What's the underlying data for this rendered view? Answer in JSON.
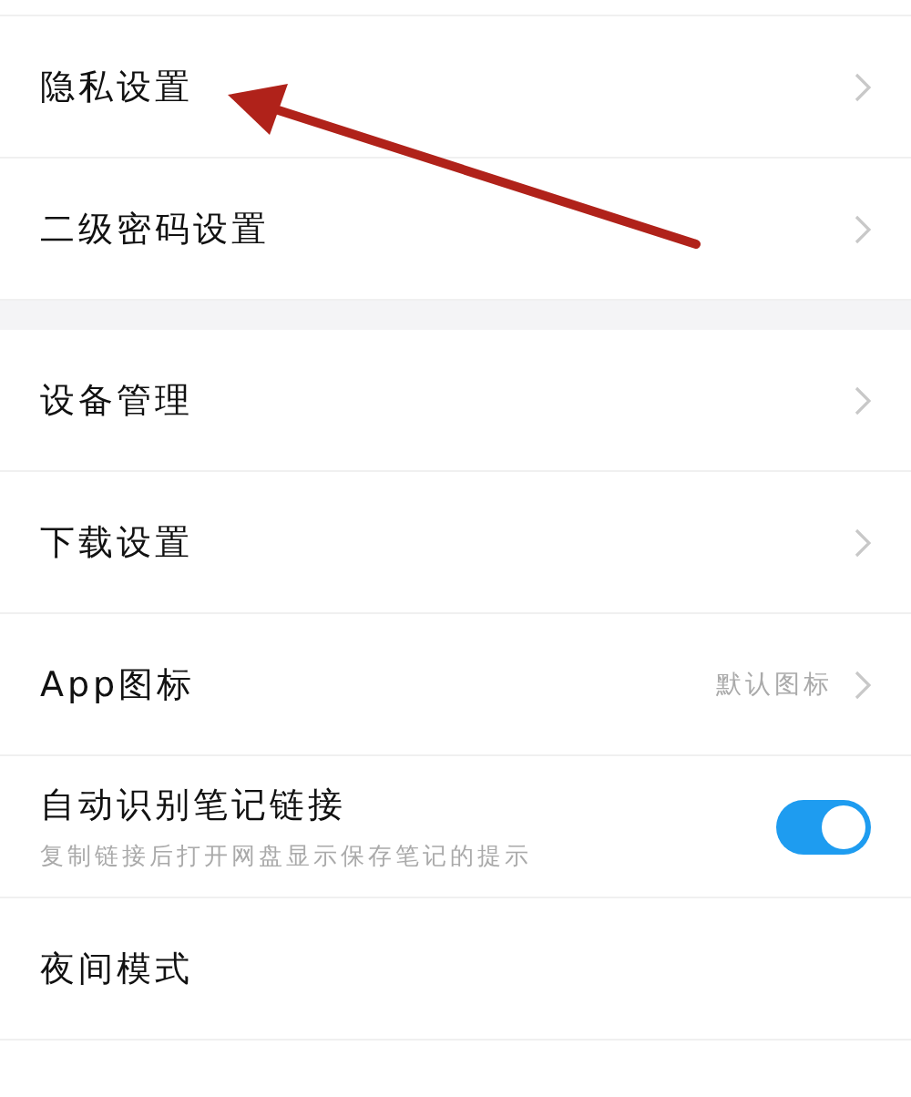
{
  "sections": [
    {
      "rows": [
        {
          "kind": "link",
          "label": "隐私设置"
        },
        {
          "kind": "link",
          "label": "二级密码设置"
        }
      ]
    },
    {
      "rows": [
        {
          "kind": "link",
          "label": "设备管理"
        },
        {
          "kind": "link",
          "label": "下载设置"
        },
        {
          "kind": "value",
          "label": "App图标",
          "value": "默认图标"
        },
        {
          "kind": "toggle",
          "label": "自动识别笔记链接",
          "subtitle": "复制链接后打开网盘显示保存笔记的提示",
          "on": true
        },
        {
          "kind": "plain",
          "label": "夜间模式"
        }
      ]
    }
  ],
  "annotation": {
    "kind": "arrow"
  }
}
